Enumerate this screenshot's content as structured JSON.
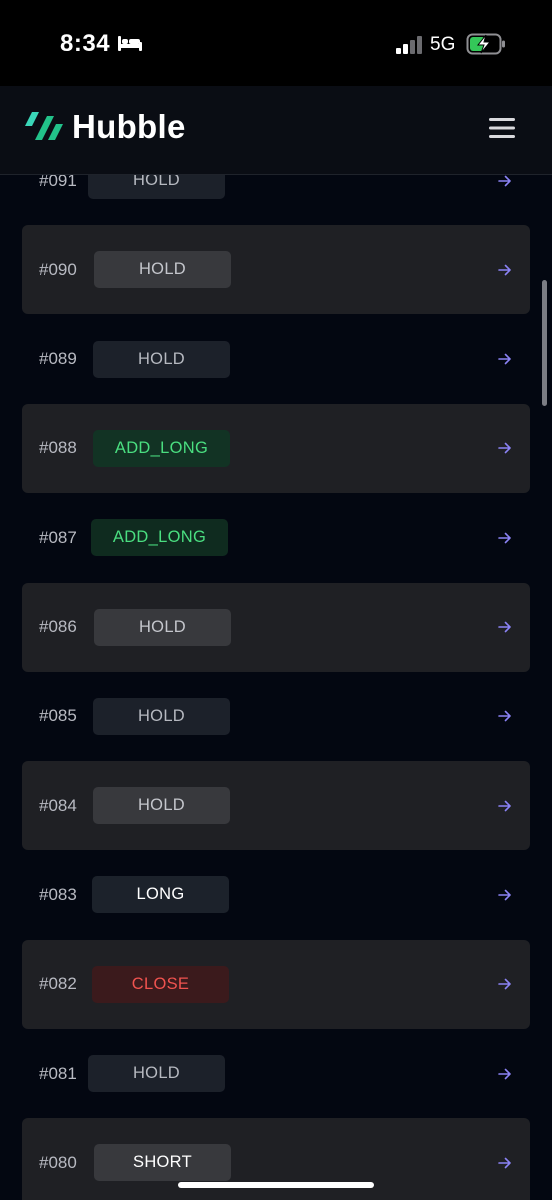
{
  "status_bar": {
    "time": "8:34",
    "network": "5G",
    "icons": [
      "bed-icon",
      "signal-icon",
      "battery-charging-icon"
    ]
  },
  "header": {
    "app_name": "Hubble",
    "icons": [
      "hubble-logo-icon",
      "menu-icon"
    ]
  },
  "colors": {
    "background": "#030711",
    "shaded_row": "#1f2024",
    "arrow": "#8b83f5",
    "logo_green": "#22c28a",
    "logo_teal": "#3ad6b8",
    "add_long_text": "#4ade80",
    "close_text": "#f0534f"
  },
  "rows": [
    {
      "id": "#091",
      "signal": "HOLD"
    },
    {
      "id": "#090",
      "signal": "HOLD"
    },
    {
      "id": "#089",
      "signal": "HOLD"
    },
    {
      "id": "#088",
      "signal": "ADD_LONG"
    },
    {
      "id": "#087",
      "signal": "ADD_LONG"
    },
    {
      "id": "#086",
      "signal": "HOLD"
    },
    {
      "id": "#085",
      "signal": "HOLD"
    },
    {
      "id": "#084",
      "signal": "HOLD"
    },
    {
      "id": "#083",
      "signal": "LONG"
    },
    {
      "id": "#082",
      "signal": "CLOSE"
    },
    {
      "id": "#081",
      "signal": "HOLD"
    },
    {
      "id": "#080",
      "signal": "SHORT"
    }
  ]
}
